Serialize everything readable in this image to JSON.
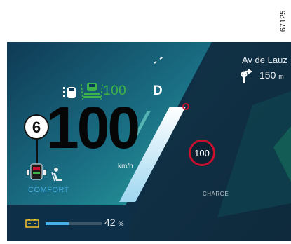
{
  "reference": "67125",
  "navigation": {
    "street": "Av de Lauz",
    "distance": "150",
    "distance_unit": "m",
    "turn_icon": "turn-right-arrow-icon"
  },
  "driving": {
    "gear": "D",
    "speed": "100",
    "speed_unit": "km/h",
    "acc_set_speed": "100",
    "speed_limit": "100",
    "mode": "COMFORT"
  },
  "callout": "6",
  "power": {
    "label": "CHARGE"
  },
  "battery": {
    "percent": "42",
    "unit": "%",
    "level": 0.42
  },
  "colors": {
    "acc_green": "#3db54a",
    "limit_red": "#c8102e",
    "mode_blue": "#4ab0e8",
    "panel": "#0b2b3f"
  }
}
